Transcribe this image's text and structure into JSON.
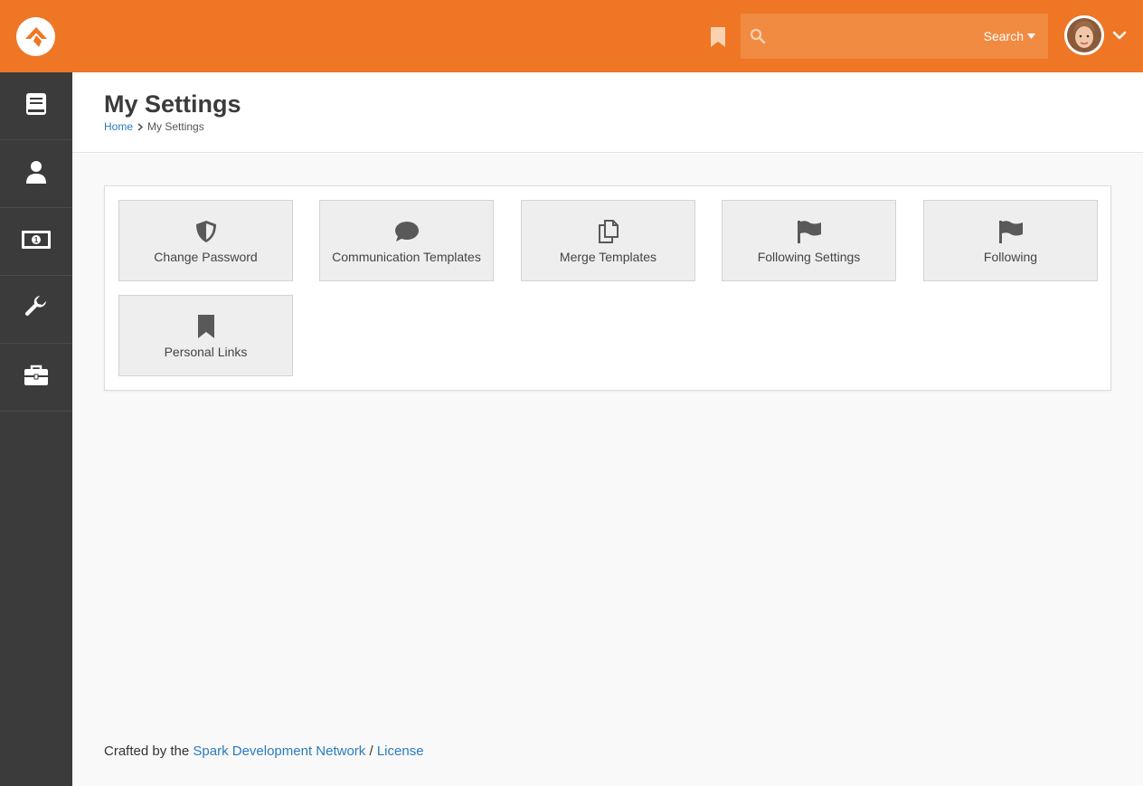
{
  "header": {
    "search_placeholder": "",
    "search_dropdown_label": "Search",
    "brand_color": "#ee7624"
  },
  "sidebar": {
    "items": [
      {
        "icon": "book-icon"
      },
      {
        "icon": "person-icon"
      },
      {
        "icon": "money-icon"
      },
      {
        "icon": "wrench-icon"
      },
      {
        "icon": "briefcase-icon"
      }
    ]
  },
  "page": {
    "title": "My Settings",
    "breadcrumb": {
      "home": "Home",
      "current": "My Settings"
    }
  },
  "tiles": [
    {
      "label": "Change Password",
      "icon": "shield-icon"
    },
    {
      "label": "Communication Templates",
      "icon": "comment-icon"
    },
    {
      "label": "Merge Templates",
      "icon": "copy-icon"
    },
    {
      "label": "Following Settings",
      "icon": "flag-icon"
    },
    {
      "label": "Following",
      "icon": "flag-icon"
    },
    {
      "label": "Personal Links",
      "icon": "bookmark-icon"
    }
  ],
  "footer": {
    "prefix": "Crafted by the",
    "link1": "Spark Development Network",
    "separator": "/",
    "link2": "License"
  }
}
